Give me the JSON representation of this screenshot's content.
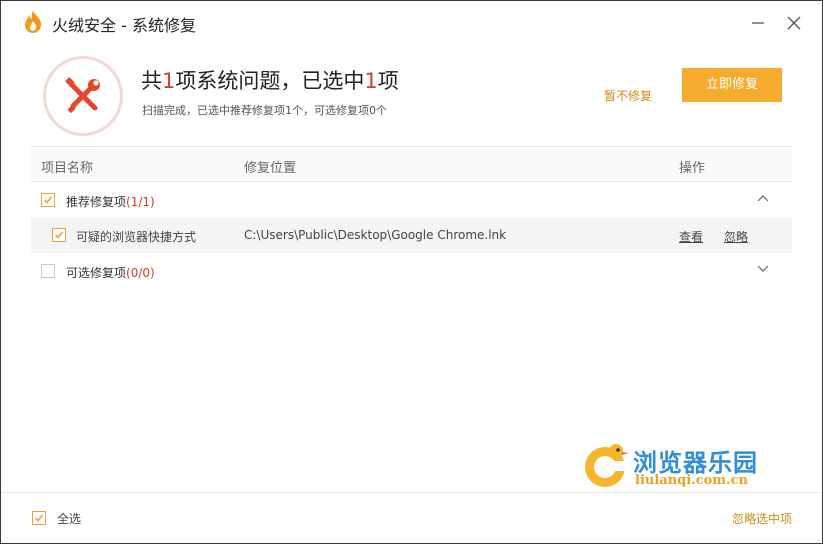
{
  "window": {
    "title": "火绒安全 - 系统修复"
  },
  "summary": {
    "prefix": "共",
    "issue_count": "1",
    "middle": "项系统问题，已选中",
    "selected_count": "1",
    "suffix": "项",
    "subtitle": "扫描完成，已选中推荐修复项1个，可选修复项0个"
  },
  "actions": {
    "later_label": "暂不修复",
    "repair_label": "立即修复"
  },
  "table": {
    "headers": [
      "项目名称",
      "修复位置",
      "操作"
    ],
    "groups": [
      {
        "label": "推荐修复项",
        "count": "(1/1)",
        "checked": true,
        "expanded": true,
        "items": [
          {
            "label": "可疑的浏览器快捷方式",
            "path": "C:\\Users\\Public\\Desktop\\Google Chrome.lnk",
            "view_label": "查看",
            "ignore_label": "忽略",
            "checked": true
          }
        ]
      },
      {
        "label": "可选修复项",
        "count": "(0/0)",
        "checked": false,
        "expanded": false,
        "items": []
      }
    ]
  },
  "watermark": {
    "title": "浏览器乐园",
    "url": "liulanqi.com.cn"
  },
  "footer": {
    "select_all_label": "全选",
    "ignore_selected_label": "忽略选中项"
  },
  "colors": {
    "accent": "#f7ab2e",
    "link": "#d28a14",
    "highlight": "#d3402b",
    "watermark_blue": "#2f8fd8"
  }
}
